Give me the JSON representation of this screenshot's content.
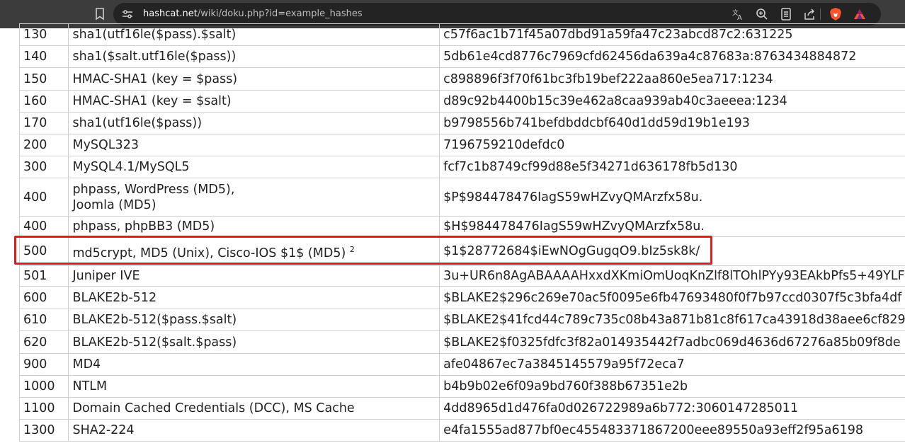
{
  "browser": {
    "url_host": "hashcat.net",
    "url_path": "/wiki/doku.php?id=example_hashes",
    "icons": [
      "bookmark-icon",
      "site-info-icon",
      "translate-icon",
      "zoom-icon",
      "reader-mode-icon",
      "share-icon",
      "brave-shield-icon",
      "brave-rewards-icon"
    ]
  },
  "table": {
    "rows": [
      {
        "mode": "130",
        "name": "sha1(utf16le($pass).$salt)",
        "example": "c57f6ac1b71f45a07dbd91a59fa47c23abcd87c2:631225"
      },
      {
        "mode": "140",
        "name": "sha1($salt.utf16le($pass))",
        "example": "5db61e4cd8776c7969cfd62456da639a4c87683a:8763434884872"
      },
      {
        "mode": "150",
        "name": "HMAC-SHA1 (key = $pass)",
        "example": "c898896f3f70f61bc3fb19bef222aa860e5ea717:1234"
      },
      {
        "mode": "160",
        "name": "HMAC-SHA1 (key = $salt)",
        "example": "d89c92b4400b15c39e462a8caa939ab40c3aeeea:1234"
      },
      {
        "mode": "170",
        "name": "sha1(utf16le($pass))",
        "example": "b9798556b741befdbddcbf640d1dd59d19b1e193"
      },
      {
        "mode": "200",
        "name": "MySQL323",
        "example": "7196759210defdc0"
      },
      {
        "mode": "300",
        "name": "MySQL4.1/MySQL5",
        "example": "fcf7c1b8749cf99d88e5f34271d636178fb5d130"
      },
      {
        "mode": "400",
        "name": "phpass, WordPress (MD5), Joomla (MD5)",
        "example": "$P$984478476IagS59wHZvyQMArzfx58u."
      },
      {
        "mode": "400",
        "name": "phpass, phpBB3 (MD5)",
        "example": "$H$984478476IagS59wHZvyQMArzfx58u."
      },
      {
        "mode": "500",
        "name": "md5crypt, MD5 (Unix), Cisco-IOS $1$ (MD5)",
        "footnote": "2",
        "example": "$1$28772684$iEwNOgGugqO9.bIz5sk8k/"
      },
      {
        "mode": "501",
        "name": "Juniper IVE",
        "example": "3u+UR6n8AgABAAAAHxxdXKmiOmUoqKnZlf8lTOhlPYy93EAkbPfs5+49YLF"
      },
      {
        "mode": "600",
        "name": "BLAKE2b-512",
        "example": "$BLAKE2$296c269e70ac5f0095e6fb47693480f0f7b97ccd0307f5c3bfa4df"
      },
      {
        "mode": "610",
        "name": "BLAKE2b-512($pass.$salt)",
        "example": "$BLAKE2$41fcd44c789c735c08b43a871b81c8f617ca43918d38aee6cf829"
      },
      {
        "mode": "620",
        "name": "BLAKE2b-512($salt.$pass)",
        "example": "$BLAKE2$f0325fdfc3f82a014935442f7adbc069d4636d67276a85b09f8de"
      },
      {
        "mode": "900",
        "name": "MD4",
        "example": "afe04867ec7a3845145579a95f72eca7"
      },
      {
        "mode": "1000",
        "name": "NTLM",
        "example": "b4b9b02e6f09a9bd760f388b67351e2b"
      },
      {
        "mode": "1100",
        "name": "Domain Cached Credentials (DCC), MS Cache",
        "example": "4dd8965d1d476fa0d026722989a6b772:3060147285011"
      },
      {
        "mode": "1300",
        "name": "SHA2-224",
        "example": "e4fa1555ad877bf0ec455483371867200eee89550a93eff2f95a6198"
      }
    ],
    "highlighted_mode": "500"
  },
  "colors": {
    "highlight": "#e21c1c",
    "topbar": "#3c3c3c",
    "brave": "#fb542b"
  }
}
